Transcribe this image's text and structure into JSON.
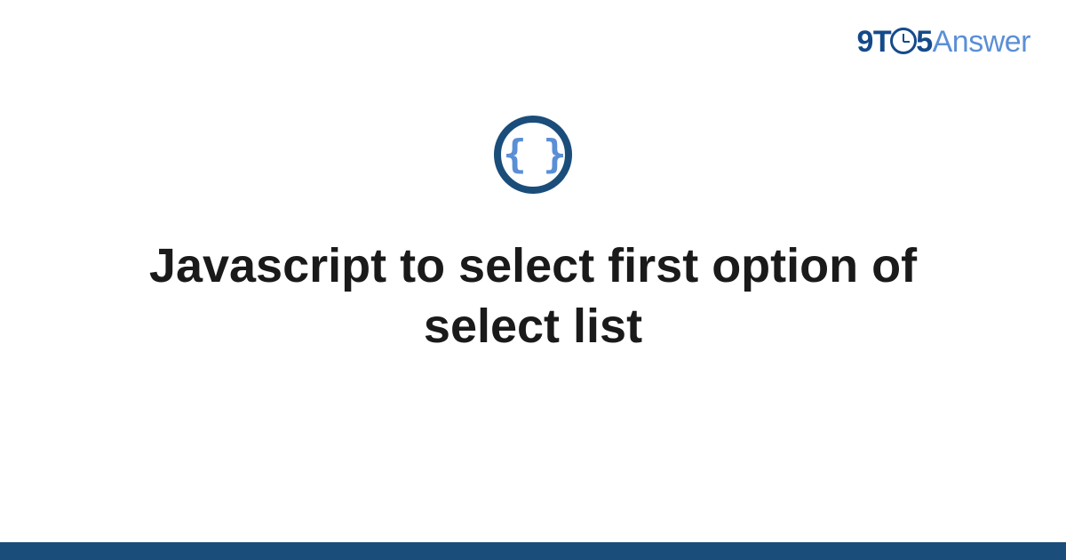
{
  "brand": {
    "prefix": "9T",
    "middle": "5",
    "suffix": "Answer"
  },
  "icon": {
    "glyph": "{ }"
  },
  "title": "Javascript to select first option of select list",
  "colors": {
    "brand_dark": "#154a8a",
    "brand_light": "#5a8fd6",
    "icon_ring": "#1a4d7a",
    "footer": "#1a4d7a"
  }
}
